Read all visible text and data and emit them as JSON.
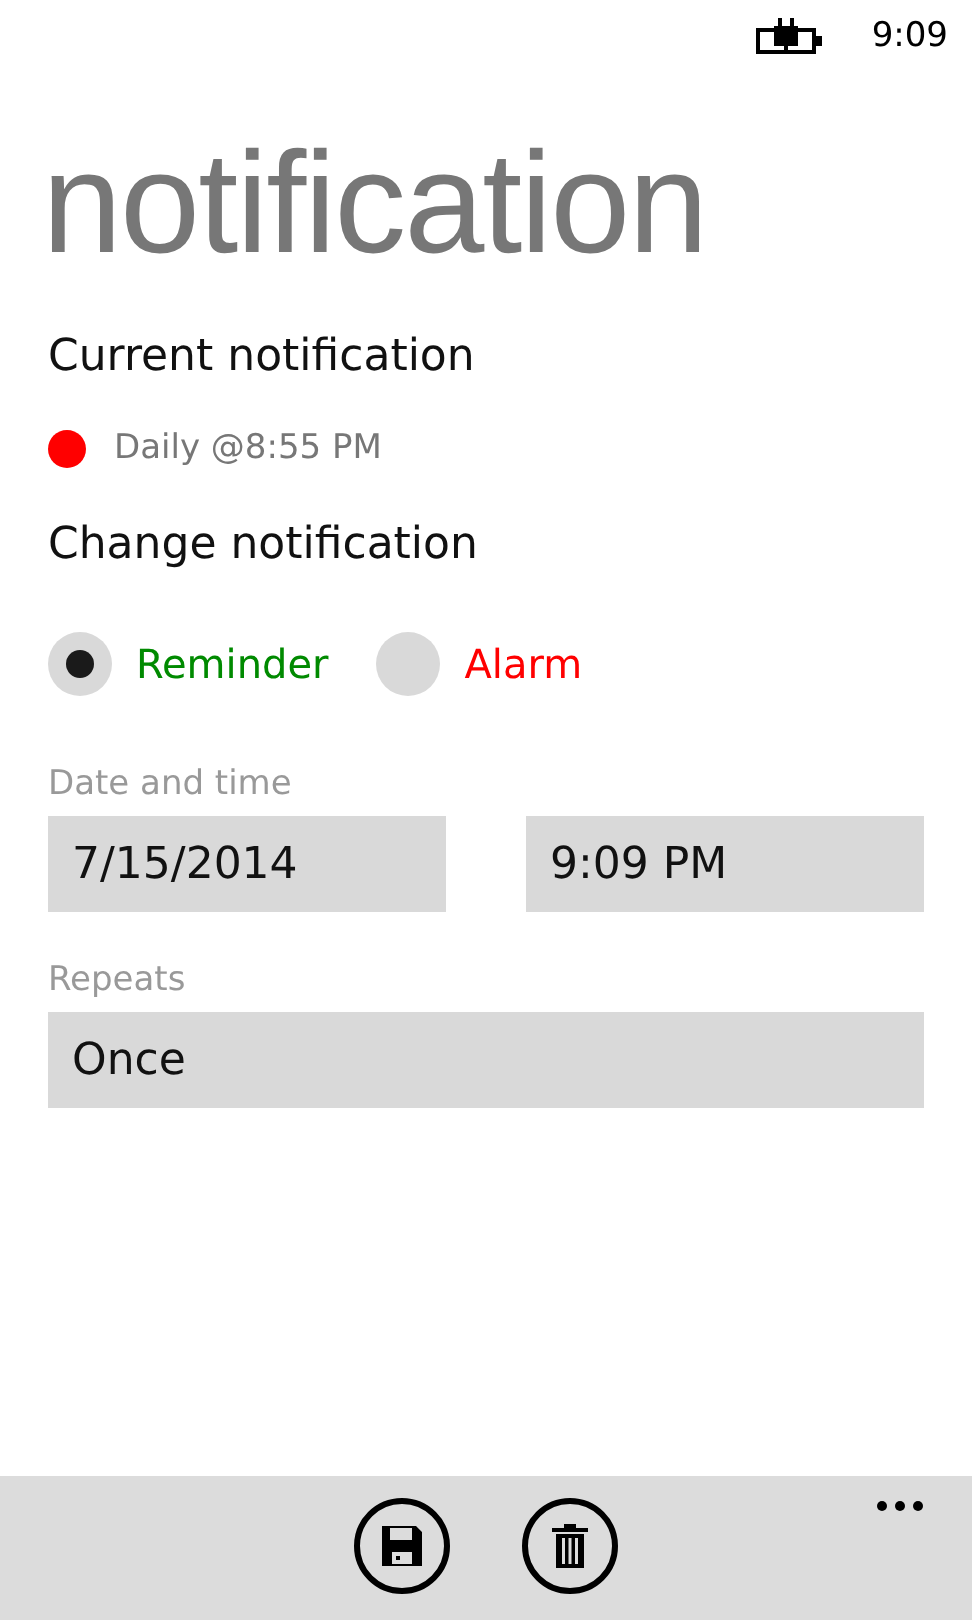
{
  "status_bar": {
    "time": "9:09",
    "charging": true
  },
  "page_title": "notification",
  "current": {
    "heading": "Current notification",
    "color": "#ff0000",
    "value": "Daily @8:55 PM"
  },
  "change": {
    "heading": "Change notification",
    "options": [
      {
        "label": "Reminder",
        "selected": true,
        "color": "#008a00"
      },
      {
        "label": "Alarm",
        "selected": false,
        "color": "#ff0000"
      }
    ]
  },
  "date_time": {
    "label": "Date and time",
    "date": "7/15/2014",
    "time": "9:09 PM"
  },
  "repeats": {
    "label": "Repeats",
    "value": "Once"
  },
  "app_bar": {
    "buttons": [
      {
        "kind": "save"
      },
      {
        "kind": "delete"
      }
    ],
    "more": true
  }
}
